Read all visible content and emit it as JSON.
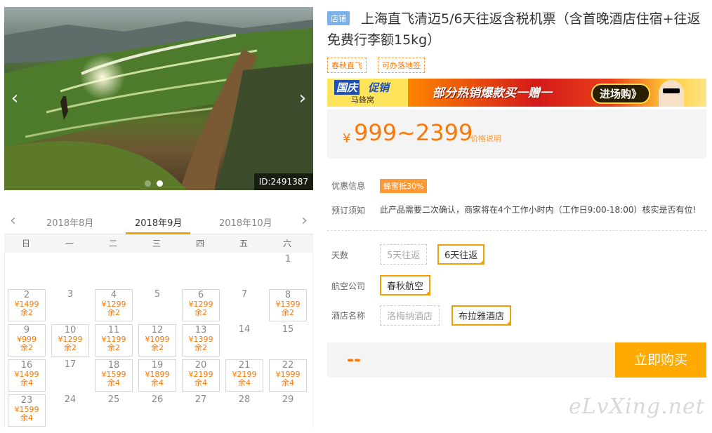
{
  "carousel": {
    "photo_id": "ID:2491387",
    "prev_arrow": "‹",
    "next_arrow": "›",
    "dot_count": 2,
    "active_dot": 1
  },
  "calendar": {
    "prev_arrow": "‹",
    "next_arrow": "›",
    "months": [
      "2018年8月",
      "2018年9月",
      "2018年10月"
    ],
    "weekdays": [
      "日",
      "一",
      "二",
      "三",
      "四",
      "五",
      "六"
    ],
    "leading_blank": 6,
    "days": [
      {
        "day": "1"
      },
      {
        "day": "2",
        "price": "¥1499",
        "stock": "余2"
      },
      {
        "day": "3"
      },
      {
        "day": "4",
        "price": "¥1299",
        "stock": "余2"
      },
      {
        "day": "5"
      },
      {
        "day": "6",
        "price": "¥1299",
        "stock": "余2"
      },
      {
        "day": "7"
      },
      {
        "day": "8",
        "price": "¥1399",
        "stock": "余2"
      },
      {
        "day": "9",
        "price": "¥999",
        "stock": "余2"
      },
      {
        "day": "10",
        "price": "¥1299",
        "stock": "余2"
      },
      {
        "day": "11",
        "price": "¥1199",
        "stock": "余2"
      },
      {
        "day": "12",
        "price": "¥1099",
        "stock": "余2"
      },
      {
        "day": "13",
        "price": "¥1399",
        "stock": "余2"
      },
      {
        "day": "14"
      },
      {
        "day": "15"
      },
      {
        "day": "16",
        "price": "¥1499",
        "stock": "余4"
      },
      {
        "day": "17"
      },
      {
        "day": "18",
        "price": "¥1599",
        "stock": "余4"
      },
      {
        "day": "19",
        "price": "¥1899",
        "stock": "余4"
      },
      {
        "day": "20",
        "price": "¥2199",
        "stock": "余4"
      },
      {
        "day": "21",
        "price": "¥2199",
        "stock": "余4"
      },
      {
        "day": "22",
        "price": "¥1999",
        "stock": "余4"
      },
      {
        "day": "23",
        "price": "¥1599",
        "stock": "余4"
      },
      {
        "day": "24"
      },
      {
        "day": "25"
      },
      {
        "day": "26"
      },
      {
        "day": "27"
      },
      {
        "day": "28"
      },
      {
        "day": "29"
      }
    ]
  },
  "product": {
    "shop_tag": "店铺",
    "title": "上海直飞清迈5/6天往返含税机票（含首晚酒店住宿+往返免费行李额15kg）",
    "features": [
      "春秋直飞",
      "可办落地签"
    ]
  },
  "banner": {
    "tag": "国庆",
    "promo": "促销",
    "brand": "马蜂窝",
    "headline": "部分热销爆款买一赠一",
    "cta": "进场购》"
  },
  "price": {
    "currency": "¥",
    "range": "999~2399",
    "note": "价格说明"
  },
  "info": {
    "promo_label": "优惠信息",
    "promo_badge": "蜂蜜抵30%",
    "notice_label": "预订须知",
    "notice_text": "此产品需要二次确认，商家将在4个工作小时内（工作日9:00-18:00）核实是否有位!"
  },
  "options": {
    "days_label": "天数",
    "days": [
      "5天往返",
      "6天往返"
    ],
    "airline_label": "航空公司",
    "airline": "春秋航空",
    "hotel_label": "酒店名称",
    "hotels": [
      "洛梅纳酒店",
      "布拉雅酒店"
    ]
  },
  "buy": {
    "total": "--",
    "button": "立即购买"
  },
  "watermark": "eLvXing.net",
  "colors": {
    "accent": "#ff7700",
    "selected_border": "#f0a000",
    "buy_button": "#ffaa00"
  }
}
